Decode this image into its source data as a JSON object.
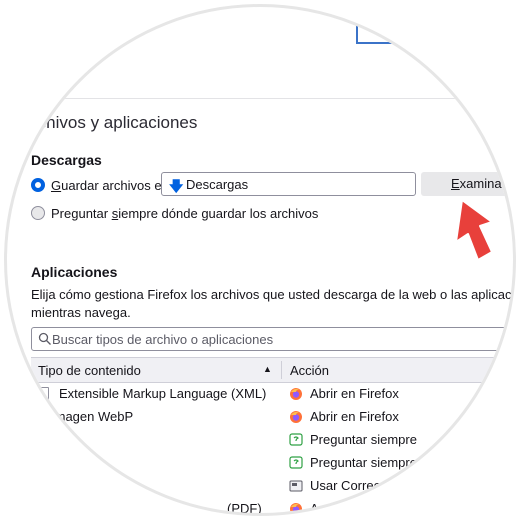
{
  "section_title": "rchivos y aplicaciones",
  "downloads": {
    "heading": "Descargas",
    "save_label_prefix": "G",
    "save_label_rest": "uardar archivos en",
    "folder": "Descargas",
    "browse_prefix": "E",
    "browse_rest": "xaminar...",
    "ask_prefix": "Preguntar ",
    "ask_underlined": "s",
    "ask_rest": "iempre dónde guardar los archivos"
  },
  "applications": {
    "heading": "Aplicaciones",
    "description_line1": "Elija cómo gestiona Firefox los archivos que usted descarga de la web o las aplicaciones que usa",
    "description_line2": "mientras navega.",
    "search_placeholder": "Buscar tipos de archivo o aplicaciones",
    "col_type": "Tipo de contenido",
    "col_action": "Acción",
    "rows": [
      {
        "type": "Extensible Markup Language (XML)",
        "action": "Abrir en Firefox",
        "icon": "firefox-icon"
      },
      {
        "type": "Imagen WebP",
        "action": "Abrir en Firefox",
        "icon": "firefox-icon"
      },
      {
        "type": "",
        "action": "Preguntar siempre",
        "icon": "ask-icon"
      },
      {
        "type": "",
        "action": "Preguntar siempre",
        "icon": "ask-icon"
      },
      {
        "type": "",
        "action": "Usar Correo (",
        "icon": "mail-app-icon"
      },
      {
        "type": "(PDF)",
        "action": "A",
        "icon": "firefox-icon"
      }
    ]
  },
  "colors": {
    "accent": "#0061e0",
    "pointer": "#e8403b"
  }
}
